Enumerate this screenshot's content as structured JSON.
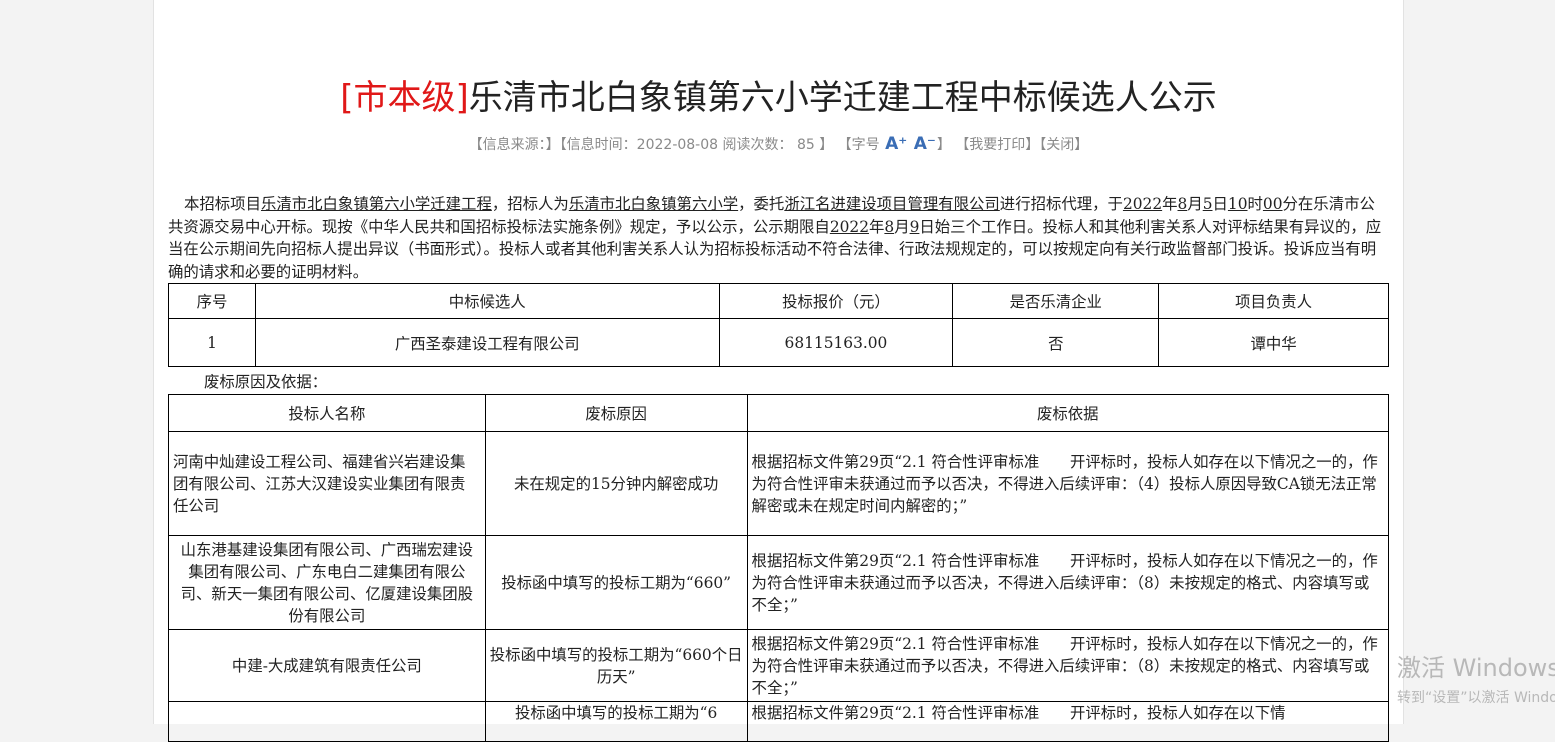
{
  "header": {
    "tag": "[市本级]",
    "title": "乐清市北白象镇第六小学迁建工程中标候选人公示"
  },
  "meta": {
    "source": "【信息来源：】",
    "time": "【信息时间：2022-08-08 阅读次数： 85 】",
    "font_open": "【字号",
    "font_up": "A⁺",
    "font_down": "A⁻",
    "font_close": "】",
    "print": "【我要打印】",
    "close": "【关闭】"
  },
  "intro": {
    "p1": "本招标项目",
    "project": "乐清市北白象镇第六小学迁建工程",
    "p2": "，招标人为",
    "tenderer": "乐清市北白象镇第六小学",
    "p3": "，委托",
    "agent": "浙江名进建设项目管理有限公司",
    "p4": "进行招标代理，于",
    "open_year": "2022",
    "p5": "年",
    "open_month": "8",
    "p6": "月",
    "open_day": "5",
    "p7": "日",
    "open_hour": "10",
    "p8": "时",
    "open_minute": "00",
    "p9": "分在乐清市公共资源交易中心开标。现按《中华人民共和国招标投标法实施条例》规定，予以公示，公示期限自",
    "pub_year": "2022",
    "p10": "年",
    "pub_month": "8",
    "p11": "月",
    "pub_day": "9",
    "p12": "日始三个工作日。投标人和其他利害关系人对评标结果有异议的，应当在公示期间先向招标人提出异议（书面形式）。投标人或者其他利害关系人认为招标投标活动不符合法律、行政法规规定的，可以按规定向有关行政监督部门投诉。投诉应当有明确的请求和必要的证明材料。"
  },
  "candidates": {
    "headers": [
      "序号",
      "中标候选人",
      "投标报价（元）",
      "是否乐清企业",
      "项目负责人"
    ],
    "rows": [
      [
        "1",
        "广西圣泰建设工程有限公司",
        "68115163.00",
        "否",
        "谭中华"
      ]
    ]
  },
  "reject_note": "废标原因及依据：",
  "rejections": {
    "headers": [
      "投标人名称",
      "废标原因",
      "废标依据"
    ],
    "rows": [
      {
        "bidder": "河南中灿建设工程公司、福建省兴岩建设集团有限公司、江苏大汉建设实业集团有限责任公司",
        "reason": "未在规定的15分钟内解密成功",
        "basis": "根据招标文件第29页“2.1 符合性评审标准　　开评标时，投标人如存在以下情况之一的，作为符合性评审未获通过而予以否决，不得进入后续评审：（4）投标人原因导致CA锁无法正常解密或未在规定时间内解密的；”"
      },
      {
        "bidder": "山东港基建设集团有限公司、广西瑞宏建设集团有限公司、广东电白二建集团有限公司、新天一集团有限公司、亿厦建设集团股份有限公司",
        "reason": "投标函中填写的投标工期为“660”",
        "basis": "根据招标文件第29页“2.1 符合性评审标准　　开评标时，投标人如存在以下情况之一的，作为符合性评审未获通过而予以否决，不得进入后续评审：（8）未按规定的格式、内容填写或不全；”"
      },
      {
        "bidder": "中建-大成建筑有限责任公司",
        "reason": "投标函中填写的投标工期为“660个日历天”",
        "basis": "根据招标文件第29页“2.1 符合性评审标准　　开评标时，投标人如存在以下情况之一的，作为符合性评审未获通过而予以否决，不得进入后续评审：（8）未按规定的格式、内容填写或不全；”"
      },
      {
        "bidder": "",
        "reason": "投标函中填写的投标工期为“6",
        "basis": "根据招标文件第29页“2.1 符合性评审标准　　开评标时，投标人如存在以下情"
      }
    ]
  },
  "watermark": {
    "line1": "激活 Windows",
    "line2": "转到“设置”以激活 Windows。"
  }
}
